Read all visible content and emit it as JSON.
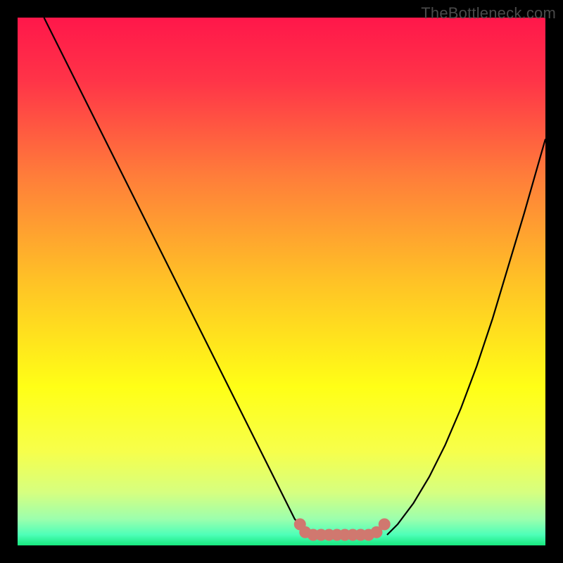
{
  "attribution": "TheBottleneck.com",
  "chart_data": {
    "type": "line",
    "title": "",
    "xlabel": "",
    "ylabel": "",
    "xlim": [
      0,
      100
    ],
    "ylim": [
      0,
      100
    ],
    "grid": false,
    "legend": false,
    "series": [
      {
        "name": "left-curve",
        "x": [
          5,
          10,
          15,
          20,
          25,
          30,
          35,
          40,
          45,
          50,
          52.5,
          55
        ],
        "values": [
          100,
          90,
          80,
          70,
          60,
          50,
          40,
          30,
          20,
          10,
          5,
          2
        ]
      },
      {
        "name": "right-curve",
        "x": [
          70,
          72,
          75,
          78,
          81,
          84,
          87,
          90,
          93,
          96,
          100
        ],
        "values": [
          2,
          4,
          8,
          13,
          19,
          26,
          34,
          43,
          53,
          63,
          77
        ]
      },
      {
        "name": "bottom-flat",
        "x": [
          55,
          57,
          60,
          63,
          66,
          68,
          70
        ],
        "values": [
          2,
          2,
          2,
          2,
          2,
          2,
          2
        ]
      }
    ],
    "background_gradient": {
      "type": "vertical",
      "stops": [
        {
          "pos": 0.0,
          "color": "#ff174a"
        },
        {
          "pos": 0.12,
          "color": "#ff3448"
        },
        {
          "pos": 0.3,
          "color": "#ff7d3a"
        },
        {
          "pos": 0.5,
          "color": "#ffc226"
        },
        {
          "pos": 0.7,
          "color": "#ffff16"
        },
        {
          "pos": 0.82,
          "color": "#f7ff4a"
        },
        {
          "pos": 0.9,
          "color": "#d6ff80"
        },
        {
          "pos": 0.95,
          "color": "#9cffad"
        },
        {
          "pos": 0.98,
          "color": "#4dffb8"
        },
        {
          "pos": 1.0,
          "color": "#17e87e"
        }
      ]
    },
    "marker_cluster": {
      "color": "#d0786f",
      "points": [
        {
          "x": 53.5,
          "y": 4.0
        },
        {
          "x": 54.5,
          "y": 2.5
        },
        {
          "x": 56.0,
          "y": 2.0
        },
        {
          "x": 57.5,
          "y": 2.0
        },
        {
          "x": 59.0,
          "y": 2.0
        },
        {
          "x": 60.5,
          "y": 2.0
        },
        {
          "x": 62.0,
          "y": 2.0
        },
        {
          "x": 63.5,
          "y": 2.0
        },
        {
          "x": 65.0,
          "y": 2.0
        },
        {
          "x": 66.5,
          "y": 2.0
        },
        {
          "x": 68.0,
          "y": 2.5
        },
        {
          "x": 69.5,
          "y": 4.0
        }
      ]
    }
  }
}
